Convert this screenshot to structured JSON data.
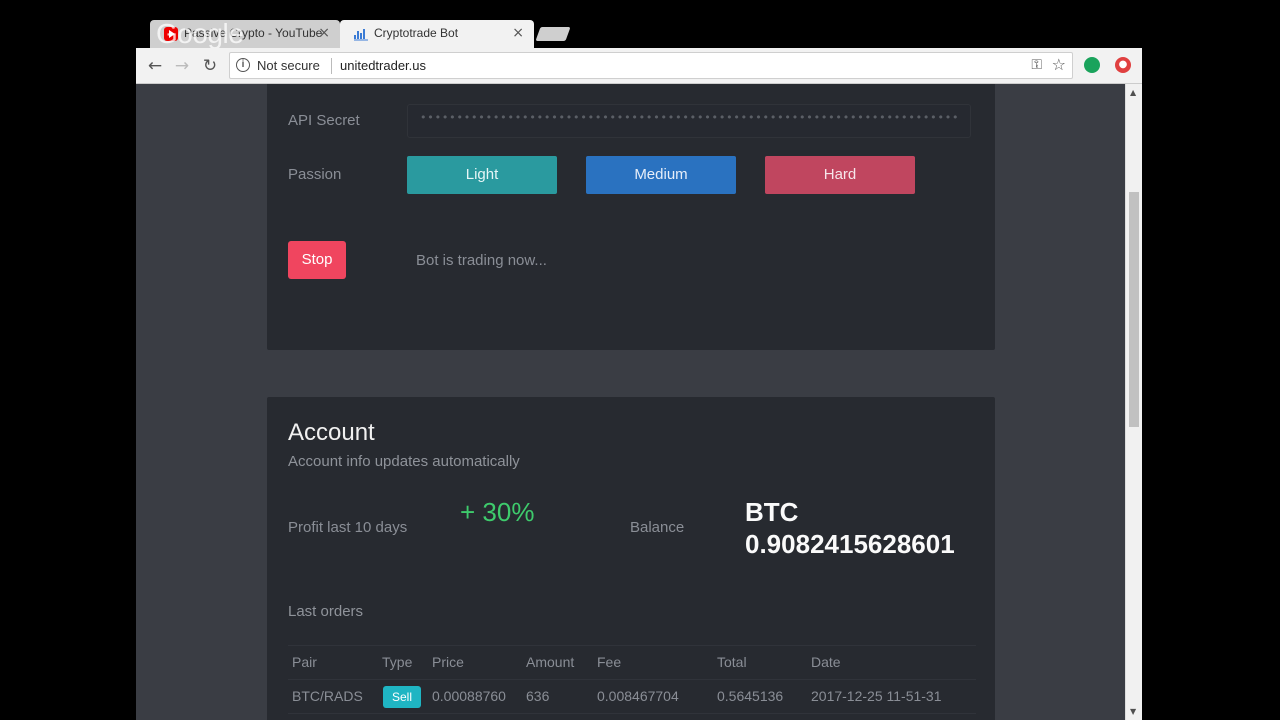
{
  "browser": {
    "watermark": "Google",
    "tabs": [
      {
        "title": "Passive Crypto - YouTube",
        "favicon": "youtube-icon",
        "close": "×"
      },
      {
        "title": "Cryptotrade Bot",
        "favicon": "chart-icon",
        "close": "×"
      }
    ],
    "security_label": "Not secure",
    "url": "unitedtrader.us",
    "icons": [
      "back-icon",
      "forward-icon",
      "reload-icon",
      "info-icon",
      "key-icon",
      "star-icon",
      "extension-icon"
    ]
  },
  "bot": {
    "api_secret_label": "API Secret",
    "api_secret_value": "••••••••••••••••••••••••••••••••••••••••••••••••••••••••••••••••••••••••••••",
    "passion_label": "Passion",
    "passion_options": [
      "Light",
      "Medium",
      "Hard"
    ],
    "stop_label": "Stop",
    "status": "Bot is trading now..."
  },
  "account": {
    "title": "Account",
    "subtitle": "Account info updates automatically",
    "profit_label": "Profit last 10 days",
    "profit_value": "+ 30%",
    "balance_label": "Balance",
    "balance_currency": "BTC",
    "balance_value": "0.9082415628601",
    "last_orders_title": "Last orders",
    "orders_columns": [
      "Pair",
      "Type",
      "Price",
      "Amount",
      "Fee",
      "Total",
      "Date"
    ],
    "orders": [
      {
        "pair": "BTC/RADS",
        "type": "Sell",
        "price": "0.00088760",
        "amount": "636",
        "fee": "0.008467704",
        "total": "0.5645136",
        "date": "2017-12-25 11-51-31"
      }
    ]
  },
  "colors": {
    "light_btn": "#2a9a9f",
    "medium_btn": "#2a72c0",
    "hard_btn": "#c0465f",
    "stop_btn": "#f0455f",
    "profit_green": "#3ecb6c",
    "sell_badge": "#1fb5c3"
  }
}
